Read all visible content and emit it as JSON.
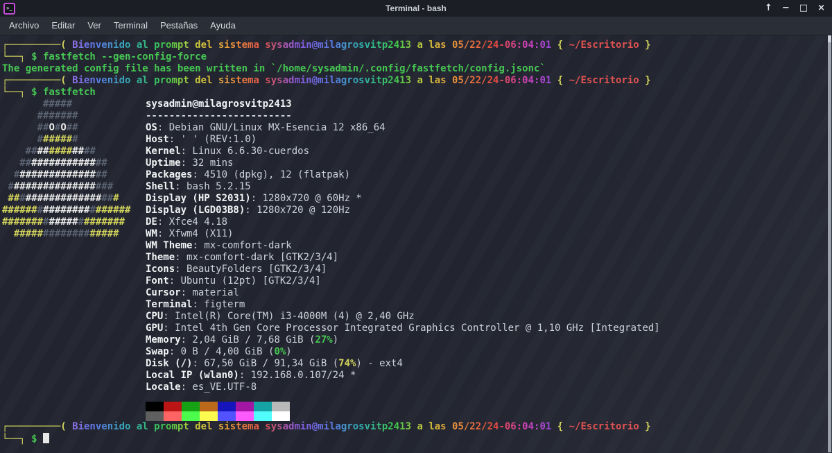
{
  "window": {
    "title": "Terminal - bash"
  },
  "icons": {
    "app": ">_",
    "shade": "↑",
    "minimize": "−",
    "maximize": "□",
    "close": "×"
  },
  "menu": {
    "items": [
      "Archivo",
      "Editar",
      "Ver",
      "Terminal",
      "Pestañas",
      "Ayuda"
    ]
  },
  "prompt": {
    "bracket_top": "┌─────────(",
    "bracket_bottom": "└──┐",
    "rainbow_text": " Bienvenido al prompt del sistema sysadmin@milagrosvitp2413 a las 05/22/24-06:04:01 ",
    "brace_open": "{",
    "path": " ~/Escritorio ",
    "brace_close": "}"
  },
  "commands": {
    "gen_config": " $ fastfetch --gen-config-force",
    "fastfetch": " $ fastfetch",
    "empty": " $ "
  },
  "output_line": "The generated config file has been written in `/home/sysadmin/.config/fastfetch/config.jsonc`",
  "fastfetch": {
    "user_host": "sysadmin@milagrosvitp2413",
    "separator": "-------------------------",
    "info": [
      {
        "label": "OS",
        "value": " Debian GNU/Linux MX-Esencia 12 x86_64"
      },
      {
        "label": "Host",
        "value": " ' ' (REV:1.0)"
      },
      {
        "label": "Kernel",
        "value": " Linux 6.6.30-cuerdos"
      },
      {
        "label": "Uptime",
        "value": " 32 mins"
      },
      {
        "label": "Packages",
        "value": " 4510 (dpkg), 12 (flatpak)"
      },
      {
        "label": "Shell",
        "value": " bash 5.2.15"
      },
      {
        "label": "Display (HP S2031)",
        "value": " 1280x720 @ 60Hz *"
      },
      {
        "label": "Display (LGD03B8)",
        "value": " 1280x720 @ 120Hz"
      },
      {
        "label": "DE",
        "value": " Xfce4 4.18"
      },
      {
        "label": "WM",
        "value": " Xfwm4 (X11)"
      },
      {
        "label": "WM Theme",
        "value": " mx-comfort-dark"
      },
      {
        "label": "Theme",
        "value": " mx-comfort-dark [GTK2/3/4]"
      },
      {
        "label": "Icons",
        "value": " BeautyFolders [GTK2/3/4]"
      },
      {
        "label": "Font",
        "value": " Ubuntu (12pt) [GTK2/3/4]"
      },
      {
        "label": "Cursor",
        "value": " material"
      },
      {
        "label": "Terminal",
        "value": " figterm"
      },
      {
        "label": "CPU",
        "value": " Intel(R) Core(TM) i3-4000M (4) @ 2,40 GHz"
      },
      {
        "label": "GPU",
        "value": " Intel 4th Gen Core Processor Integrated Graphics Controller @ 1,10 GHz [Integrated]"
      },
      {
        "label": "Memory",
        "value": " 2,04 GiB / 7,68 GiB (",
        "percent": "27%",
        "percent_color": "green",
        "suffix": ")"
      },
      {
        "label": "Swap",
        "value": " 0 B / 4,00 GiB (",
        "percent": "0%",
        "percent_color": "green",
        "suffix": ")"
      },
      {
        "label": "Disk (/)",
        "value": " 67,50 GiB / 91,34 GiB (",
        "percent": "74%",
        "percent_color": "yellow",
        "suffix": ") - ext4"
      },
      {
        "label": "Local IP (wlan0)",
        "value": " 192.168.0.107/24 *"
      },
      {
        "label": "Locale",
        "value": " es_VE.UTF-8"
      }
    ],
    "logo": [
      [
        [
          "g",
          "       #####"
        ]
      ],
      [
        [
          "g",
          "      #######"
        ]
      ],
      [
        [
          "g",
          "      ##"
        ],
        [
          "w",
          "O"
        ],
        [
          "g",
          "#"
        ],
        [
          "w",
          "O"
        ],
        [
          "g",
          "##"
        ]
      ],
      [
        [
          "g",
          "      #"
        ],
        [
          "y",
          "#####"
        ],
        [
          "g",
          "#"
        ]
      ],
      [
        [
          "g",
          "    ##"
        ],
        [
          "w",
          "##"
        ],
        [
          "y",
          "####"
        ],
        [
          "w",
          "##"
        ],
        [
          "g",
          "##"
        ]
      ],
      [
        [
          "g",
          "   ##"
        ],
        [
          "w",
          "###########"
        ],
        [
          "g",
          "##"
        ]
      ],
      [
        [
          "g",
          "  #"
        ],
        [
          "w",
          "#############"
        ],
        [
          "g",
          "##"
        ]
      ],
      [
        [
          "g",
          " #"
        ],
        [
          "w",
          "##############"
        ],
        [
          "g",
          "###"
        ]
      ],
      [
        [
          "y",
          " ##"
        ],
        [
          "g",
          "#"
        ],
        [
          "w",
          "#############"
        ],
        [
          "g",
          "##"
        ],
        [
          "y",
          "#"
        ]
      ],
      [
        [
          "y",
          "######"
        ],
        [
          "g",
          "#"
        ],
        [
          "w",
          "########"
        ],
        [
          "g",
          "#"
        ],
        [
          "y",
          "######"
        ]
      ],
      [
        [
          "y",
          "#######"
        ],
        [
          "g",
          "#"
        ],
        [
          "w",
          "#####"
        ],
        [
          "g",
          "#"
        ],
        [
          "y",
          "#######"
        ]
      ],
      [
        [
          "y",
          "  #####"
        ],
        [
          "g",
          "########"
        ],
        [
          "y",
          "#####"
        ]
      ]
    ],
    "palette": {
      "row1": [
        "#000000",
        "#bb1515",
        "#15a315",
        "#bb6a1b",
        "#1515bb",
        "#a315a3",
        "#15a3a3",
        "#b9b9b9"
      ],
      "row2": [
        "#5f5f5f",
        "#ff6464",
        "#4cfc4c",
        "#fcfc50",
        "#5252ff",
        "#fc5afc",
        "#50fcfc",
        "#ffffff"
      ]
    }
  },
  "colors": {
    "accent_green": "#46c653",
    "accent_yellow": "#d3d45c",
    "accent_red": "#e05252",
    "logo_gray": "#5b6372",
    "logo_white": "#e9e9e9"
  }
}
